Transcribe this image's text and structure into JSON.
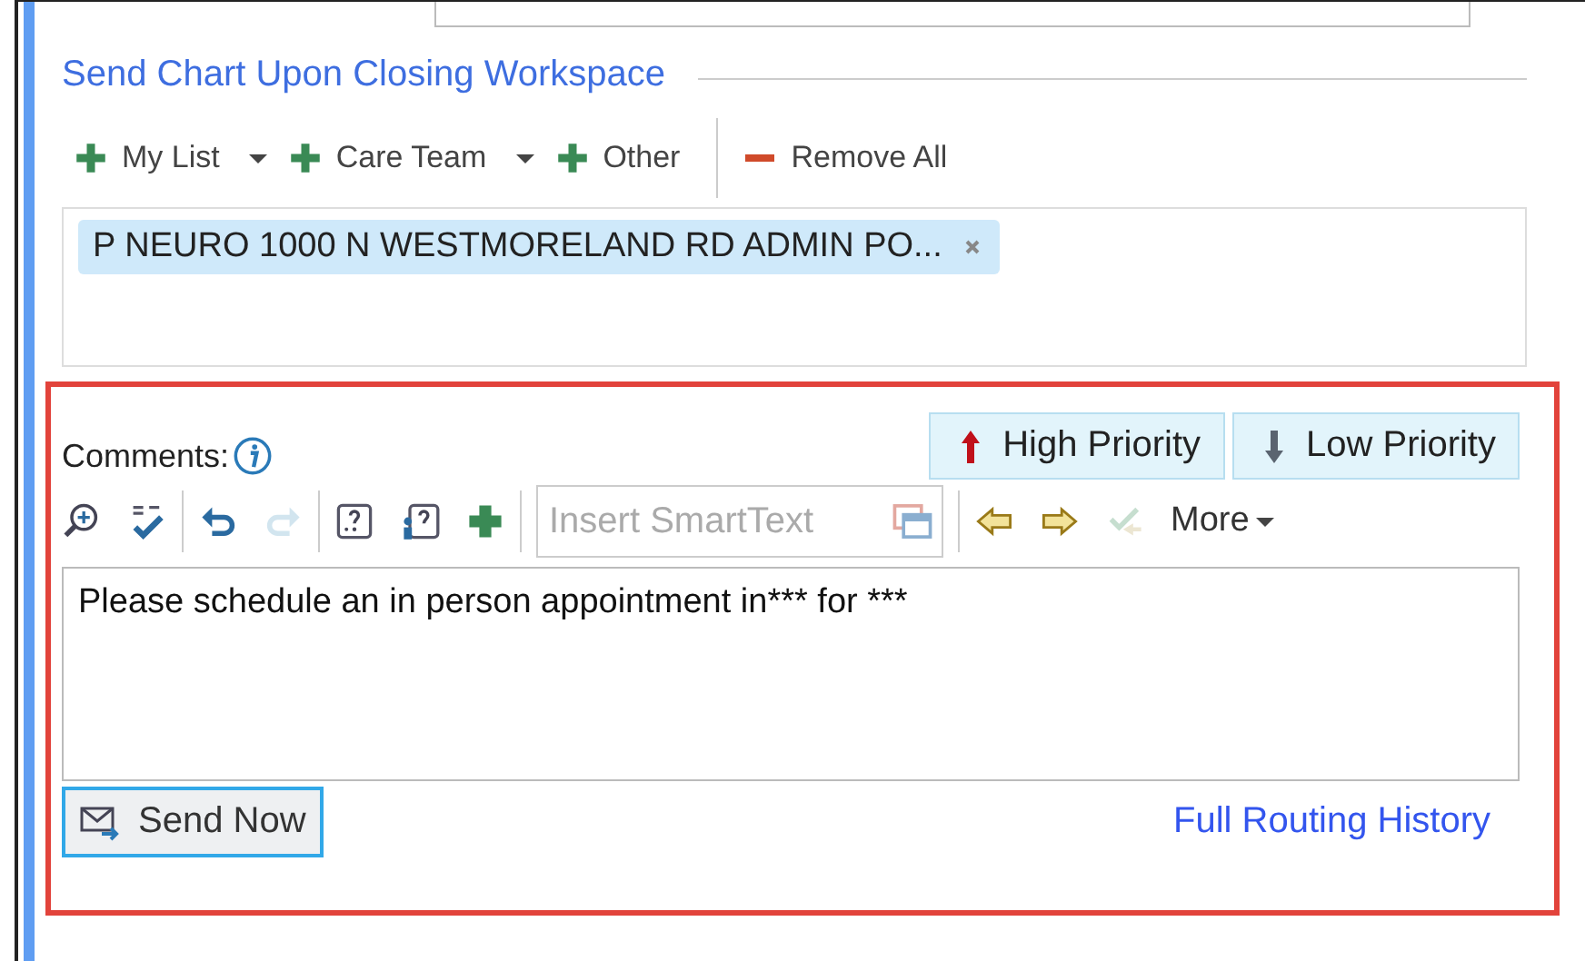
{
  "section_title": "Send Chart Upon Closing Workspace",
  "recipient_toolbar": [
    {
      "kind": "add",
      "label": "My List",
      "dropdown": true
    },
    {
      "kind": "add",
      "label": "Care Team",
      "dropdown": true
    },
    {
      "kind": "add",
      "label": "Other",
      "dropdown": false
    },
    {
      "kind": "remove",
      "label": "Remove All",
      "dropdown": false
    }
  ],
  "recipients": [
    {
      "label": "P NEURO 1000 N WESTMORELAND RD ADMIN PO..."
    }
  ],
  "comments": {
    "label": "Comments:",
    "priority_buttons": [
      {
        "kind": "high",
        "label": "High Priority"
      },
      {
        "kind": "low",
        "label": "Low Priority"
      }
    ],
    "toolbar": [
      {
        "kind": "zoom",
        "disabled": false
      },
      {
        "kind": "spell",
        "disabled": false
      },
      {
        "kind": "sep"
      },
      {
        "kind": "undo",
        "disabled": false
      },
      {
        "kind": "redo",
        "disabled": true
      },
      {
        "kind": "sep"
      },
      {
        "kind": "blank",
        "disabled": false
      },
      {
        "kind": "userblank",
        "disabled": false
      },
      {
        "kind": "plus",
        "disabled": false
      },
      {
        "kind": "sep"
      },
      {
        "kind": "smarttext",
        "placeholder": "Insert SmartText"
      },
      {
        "kind": "sep"
      },
      {
        "kind": "prev",
        "disabled": false
      },
      {
        "kind": "next",
        "disabled": false
      },
      {
        "kind": "check",
        "disabled": true
      },
      {
        "kind": "more",
        "label": "More"
      }
    ],
    "text": "Please schedule an in person appointment in*** for ***",
    "send_button": "Send Now",
    "history_link": "Full Routing History"
  }
}
